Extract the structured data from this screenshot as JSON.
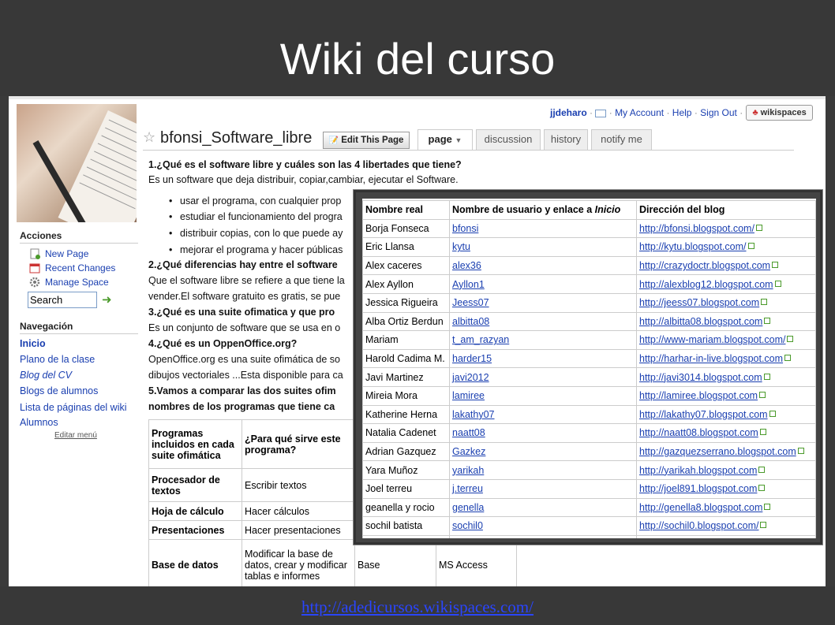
{
  "slide": {
    "title": "Wiki del curso",
    "footer_link": "http://adedicursos.wikispaces.com/"
  },
  "sidebar": {
    "actions_heading": "Acciones",
    "actions": [
      {
        "label": "New Page",
        "icon": "new-page-icon"
      },
      {
        "label": "Recent Changes",
        "icon": "calendar-icon"
      },
      {
        "label": "Manage Space",
        "icon": "gear-icon"
      }
    ],
    "search_value": "Search",
    "nav_heading": "Navegación",
    "nav": [
      "Inicio",
      "Plano de la clase",
      "Blog del CV",
      "Blogs de alumnos",
      "Lista de páginas del wiki",
      "Alumnos"
    ],
    "edit_menu": "Editar menú"
  },
  "topbar": {
    "user": "jjdeharo",
    "my_account": "My Account",
    "help": "Help",
    "sign_out": "Sign Out",
    "brand": "wikispaces"
  },
  "page": {
    "name": "bfonsi_Software_libre",
    "edit_button": "Edit This Page",
    "tabs": [
      "page",
      "discussion",
      "history",
      "notify me"
    ]
  },
  "content": {
    "q1": "1.¿Qué es el software libre y cuáles son las 4 libertades que tiene?",
    "a1": "Es un software que deja distribuir, copiar,cambiar, ejecutar el Software.",
    "bullets": [
      "usar el programa, con cualquier prop",
      "estudiar el funcionamiento del progra",
      "distribuir copias, con lo que puede ay",
      "mejorar el programa y hacer públicas"
    ],
    "q2": "2.¿Qué diferencias hay entre el software",
    "a2a": "Que el software libre se refiere a que tiene la",
    "a2b": "vender.El software gratuito es gratis, se pue",
    "q3": "3.¿Qué es una suite ofimatica y que pro",
    "a3": "Es un conjunto de software que se usa en o",
    "q4": "4.¿Qué es un OppenOffice.org?",
    "a4a": "OpenOffice.org es una suite ofimática de so",
    "a4b": "dibujos vectoriales ...Esta disponible para ca",
    "q5a": "5.Vamos a comparar las dos suites ofim",
    "q5b": "nombres de los programas que tiene ca"
  },
  "programs_table": {
    "header": [
      "Programas incluidos en cada suite ofimática",
      "¿Para qué sirve este programa?"
    ],
    "rows": [
      [
        "Procesador de textos",
        "Escribir textos",
        "",
        ""
      ],
      [
        "Hoja de cálculo",
        "Hacer cálculos",
        "",
        ""
      ],
      [
        "Presentaciones",
        "Hacer presentaciones",
        "",
        ""
      ],
      [
        "Base de datos",
        "Modificar la base de datos, crear y modificar tablas e informes",
        "Base",
        "MS Access"
      ]
    ]
  },
  "blogs_table": {
    "headers": {
      "real_name": "Nombre real",
      "user_prefix": "Nombre de usuario y enlace a ",
      "user_italic": "Inicio",
      "blog": "Dirección del blog"
    },
    "rows": [
      {
        "name": "Borja Fonseca",
        "user": "bfonsi",
        "blog": "http://bfonsi.blogspot.com/"
      },
      {
        "name": "Eric Llansa",
        "user": "kytu",
        "blog": "http://kytu.blogspot.com/"
      },
      {
        "name": "Alex caceres",
        "user": "alex36",
        "blog": "http://crazydoctr.blogspot.com"
      },
      {
        "name": "Alex Ayllon",
        "user": "Ayllon1",
        "blog": "http://alexblog12.blogspot.com"
      },
      {
        "name": "Jessica Rigueira",
        "user": "Jeess07",
        "blog": "http://jeess07.blogspot.com"
      },
      {
        "name": "Alba Ortiz Berdun",
        "user": "albitta08",
        "blog": "http://albitta08.blogspot.com"
      },
      {
        "name": "Mariam",
        "user": "t_am_razyan",
        "blog": "http://www-mariam.blogspot.com/"
      },
      {
        "name": "Harold Cadima M.",
        "user": "harder15",
        "blog": "http://harhar-in-live.blogspot.com"
      },
      {
        "name": "Javi Martinez",
        "user": "javi2012",
        "blog": "http://javi3014.blogspot.com"
      },
      {
        "name": "Mireia Mora",
        "user": "lamiree",
        "blog": "http://lamiree.blogspot.com"
      },
      {
        "name": "Katherine Herna",
        "user": "lakathy07",
        "blog": "http://lakathy07.blogspot.com"
      },
      {
        "name": "Natalia Cadenet",
        "user": "naatt08",
        "blog": "http://naatt08.blogspot.com"
      },
      {
        "name": "Adrian Gazquez",
        "user": "Gazkez",
        "blog": "http://gazquezserrano.blogspot.com"
      },
      {
        "name": "Yara Muñoz",
        "user": "yarikah",
        "blog": "http://yarikah.blogspot.com"
      },
      {
        "name": "Joel terreu",
        "user": "j.terreu",
        "blog": "http://joel891.blogspot.com"
      },
      {
        "name": "geanella y rocio",
        "user": "genella",
        "blog": "http://genella8.blogspot.com"
      },
      {
        "name": "sochil batista",
        "user": "sochil0",
        "blog": "http://sochil0.blogspot.com/"
      },
      {
        "name": "",
        "user": "",
        "blog": ""
      }
    ]
  }
}
